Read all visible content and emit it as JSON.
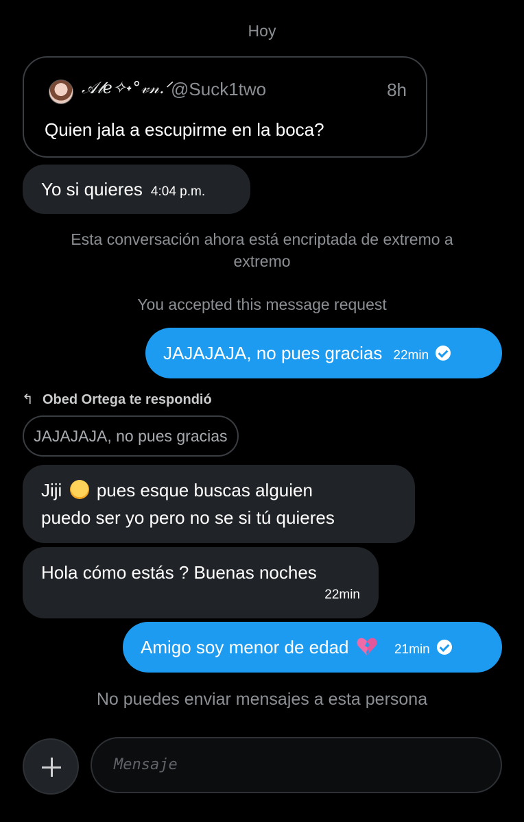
{
  "date_label": "Hoy",
  "quoted_post": {
    "author_name": "𝒜𝓁𝑒✧˖°𝓋𝓃.ᐟ",
    "handle": "@Suck1two",
    "time": "8h",
    "text": "Quien jala a escupirme en la boca?"
  },
  "messages": {
    "m1": {
      "text": "Yo si quieres",
      "time": "4:04 p.m."
    },
    "encrypted_notice": "Esta conversación ahora está encriptada de extremo a extremo",
    "accepted_notice": "You accepted this message request",
    "m2": {
      "text": "JAJAJAJA, no pues gracias",
      "time": "22min"
    },
    "reply_label": "Obed Ortega te respondió",
    "reply_quote": "JAJAJAJA, no pues gracias",
    "m3": {
      "text_before": "Jiji",
      "text_after": "pues esque buscas alguien",
      "text_line2": "puedo ser yo pero no se si tú quieres",
      "emoji": "giggle-emoji"
    },
    "m4": {
      "text": "Hola cómo estás ? Buenas noches",
      "time": "22min"
    },
    "m5": {
      "text": "Amigo soy menor de edad",
      "time": "21min",
      "emoji": "broken-heart-emoji"
    }
  },
  "blocked_notice": "No puedes enviar mensajes a esta persona",
  "composer": {
    "placeholder": "Mensaje",
    "add_icon": "plus-icon"
  },
  "colors": {
    "background": "#000000",
    "incoming_bubble": "#202327",
    "outgoing_bubble": "#1d9bf0",
    "muted_text": "#8b8f94"
  }
}
